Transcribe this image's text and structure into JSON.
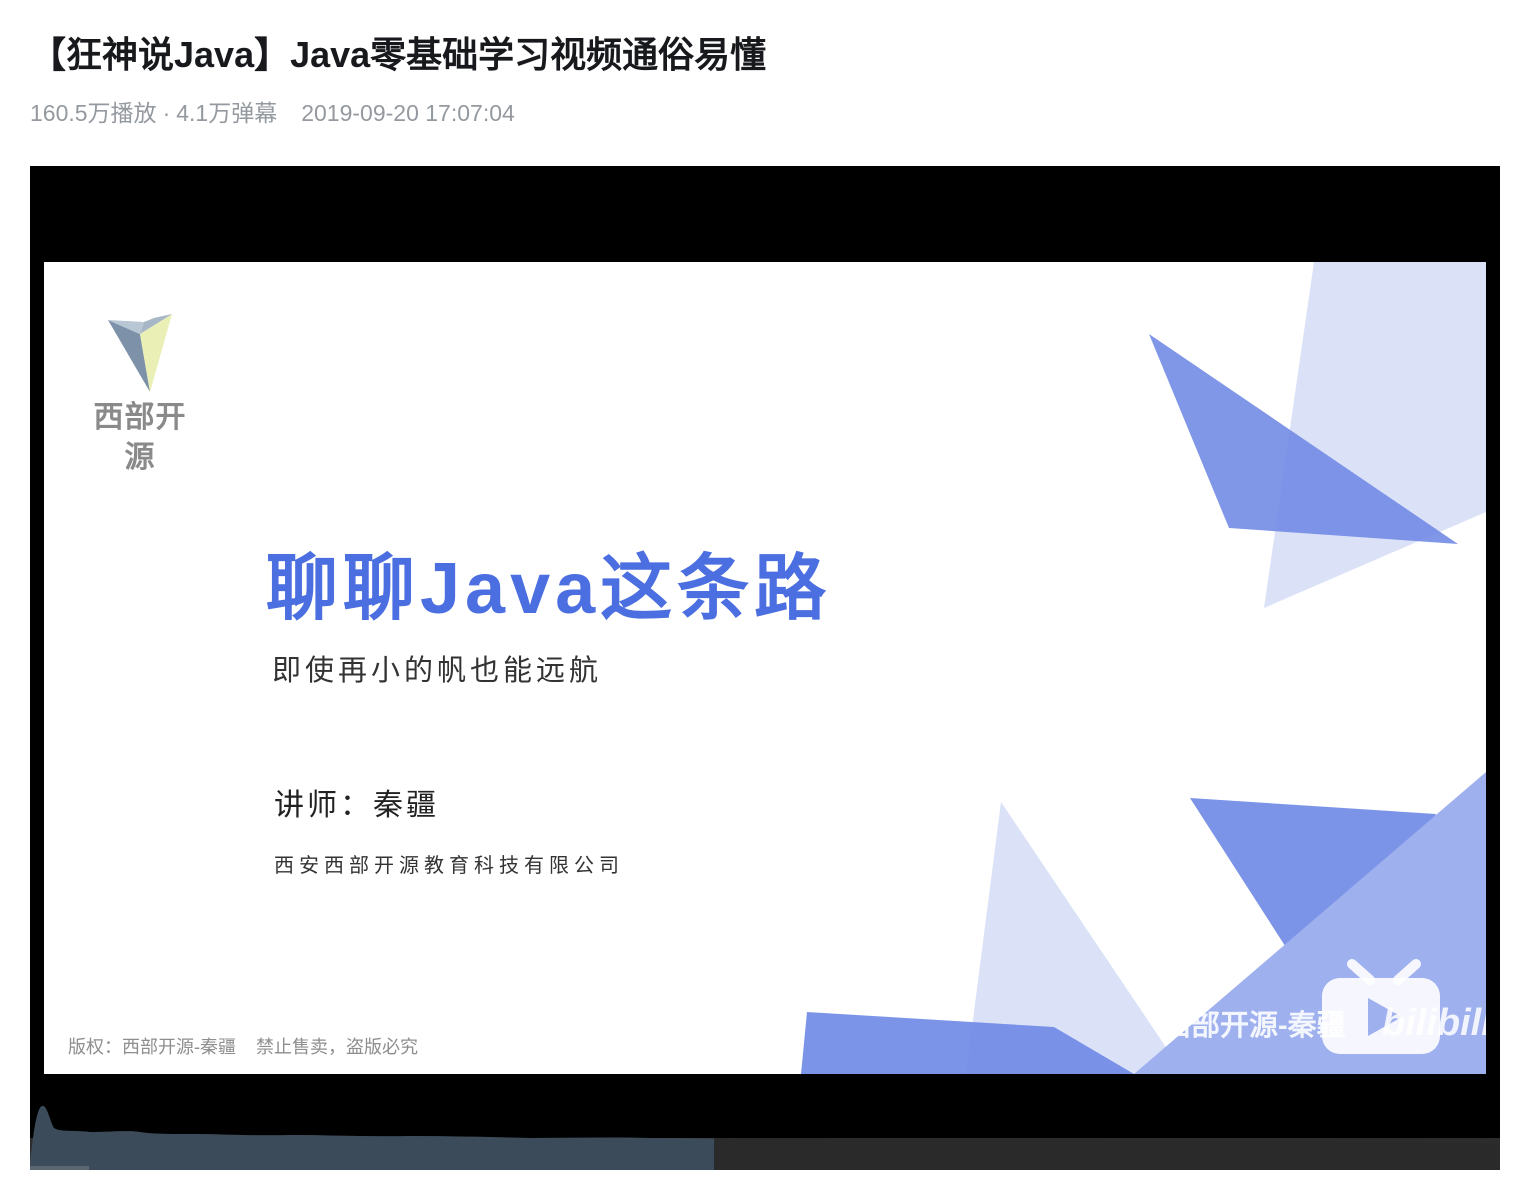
{
  "video": {
    "title": "【狂神说Java】Java零基础学习视频通俗易懂",
    "views": "160.5万播放",
    "separator": "·",
    "danmaku": "4.1万弹幕",
    "published": "2019-09-20 17:07:04"
  },
  "slide": {
    "logo_text": "西部开源",
    "headline": "聊聊Java这条路",
    "tagline": "即使再小的帆也能远航",
    "lecturer": "讲师：秦疆",
    "company": "西安西部开源教育科技有限公司",
    "copyright": "版权：西部开源-秦疆",
    "copyright_note": "禁止售卖，盗版必究",
    "watermark": "西部开源-秦疆",
    "platform_mark": "bilibili"
  },
  "player": {
    "progress_played": 0.04,
    "progress_buffered": 0.465
  },
  "colors": {
    "accent_blue": "#4b6ee0",
    "triangle_dark": "#7b93e6",
    "triangle_light": "#d6ddf7",
    "heat_played": "#3b4b5a",
    "heat_unplayed": "#2c2c2c"
  }
}
